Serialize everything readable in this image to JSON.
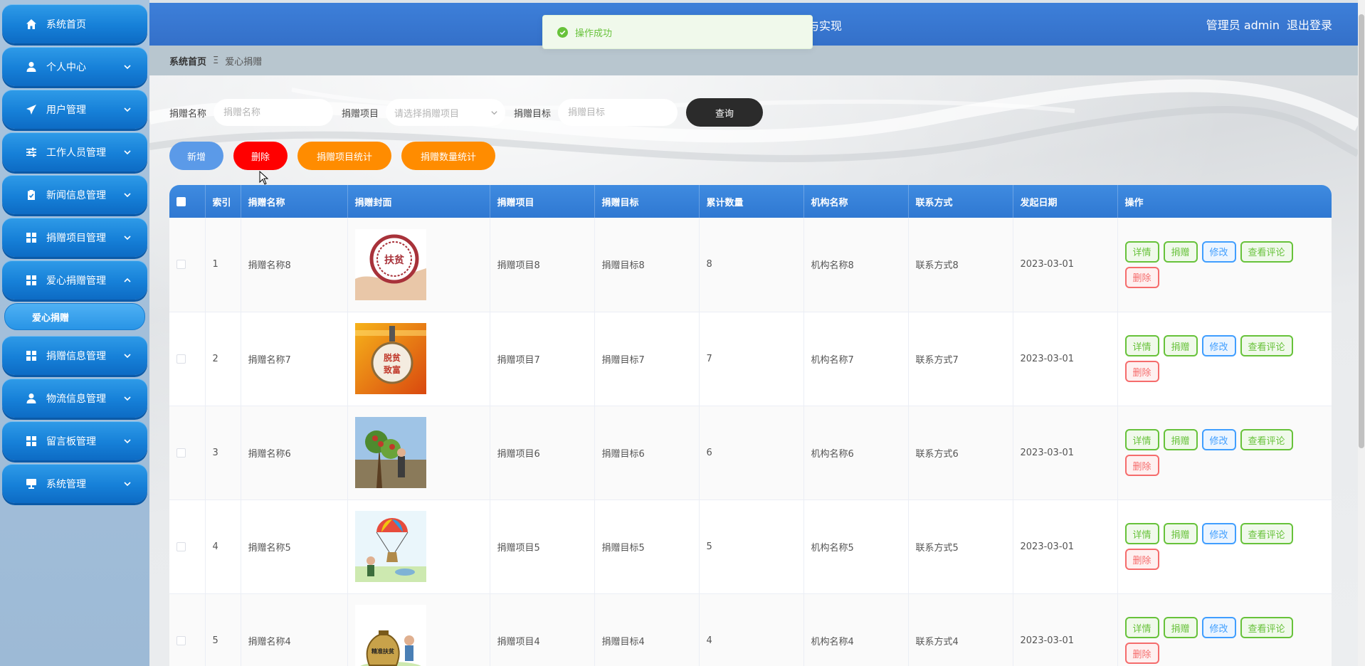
{
  "header": {
    "title_fragment": "与实现",
    "user_label": "管理员 admin",
    "logout": "退出登录"
  },
  "toast": {
    "message": "操作成功"
  },
  "sidebar": {
    "items": [
      {
        "label": "系统首页",
        "icon": "home-icon",
        "expandable": false
      },
      {
        "label": "个人中心",
        "icon": "person-icon",
        "expandable": true
      },
      {
        "label": "用户管理",
        "icon": "paper-plane-icon",
        "expandable": true
      },
      {
        "label": "工作人员管理",
        "icon": "sliders-icon",
        "expandable": true
      },
      {
        "label": "新闻信息管理",
        "icon": "clipboard-icon",
        "expandable": true
      },
      {
        "label": "捐赠项目管理",
        "icon": "grid-icon",
        "expandable": true
      },
      {
        "label": "爱心捐赠管理",
        "icon": "grid-icon",
        "expandable": true,
        "expanded": true
      }
    ],
    "sub_item": "爱心捐赠",
    "items_after": [
      {
        "label": "捐赠信息管理",
        "icon": "grid-icon",
        "expandable": true
      },
      {
        "label": "物流信息管理",
        "icon": "person-icon",
        "expandable": true
      },
      {
        "label": "留言板管理",
        "icon": "grid-icon",
        "expandable": true
      },
      {
        "label": "系统管理",
        "icon": "monitor-icon",
        "expandable": true
      }
    ]
  },
  "breadcrumb": {
    "home": "系统首页",
    "separator": "Ξ",
    "current": "爱心捐赠"
  },
  "search": {
    "name_label": "捐赠名称",
    "name_placeholder": "捐赠名称",
    "project_label": "捐赠项目",
    "project_placeholder": "请选择捐赠项目",
    "target_label": "捐赠目标",
    "target_placeholder": "捐赠目标",
    "query_button": "查询"
  },
  "actions": {
    "add": "新增",
    "delete": "删除",
    "project_stats": "捐赠项目统计",
    "quantity_stats": "捐赠数量统计"
  },
  "table": {
    "columns": [
      "索引",
      "捐赠名称",
      "捐赠封面",
      "捐赠项目",
      "捐赠目标",
      "累计数量",
      "机构名称",
      "联系方式",
      "发起日期",
      "操作"
    ],
    "rows": [
      {
        "index": "1",
        "name": "捐赠名称8",
        "cover": "seal-image",
        "project": "捐赠项目8",
        "target": "捐赠目标8",
        "count": "8",
        "org": "机构名称8",
        "contact": "联系方式8",
        "date": "2023-03-01"
      },
      {
        "index": "2",
        "name": "捐赠名称7",
        "cover": "poverty-badge-image",
        "project": "捐赠项目7",
        "target": "捐赠目标7",
        "count": "7",
        "org": "机构名称7",
        "contact": "联系方式7",
        "date": "2023-03-01"
      },
      {
        "index": "3",
        "name": "捐赠名称6",
        "cover": "orchard-image",
        "project": "捐赠项目6",
        "target": "捐赠目标6",
        "count": "6",
        "org": "机构名称6",
        "contact": "联系方式6",
        "date": "2023-03-01"
      },
      {
        "index": "4",
        "name": "捐赠名称5",
        "cover": "balloon-image",
        "project": "捐赠项目5",
        "target": "捐赠目标5",
        "count": "5",
        "org": "机构名称5",
        "contact": "联系方式5",
        "date": "2023-03-01"
      },
      {
        "index": "5",
        "name": "捐赠名称4",
        "cover": "moneybag-image",
        "project": "捐赠项目4",
        "target": "捐赠目标4",
        "count": "4",
        "org": "机构名称4",
        "contact": "联系方式4",
        "date": "2023-03-01"
      }
    ],
    "row_ops": {
      "detail": "详情",
      "donate": "捐赠",
      "edit": "修改",
      "comments": "查看评论",
      "delete": "删除"
    }
  },
  "cover_texts": {
    "seal": "扶贫",
    "badge_top": "脱贫",
    "badge_bottom": "致富",
    "moneybag": "精准扶贫"
  },
  "colors": {
    "header_blue": "#3d7fd9",
    "nav_blue": "#1680d8",
    "success_green": "#67c23a",
    "danger_red": "#ff0000",
    "stat_orange": "#ff8c00",
    "edit_blue": "#409eff"
  }
}
